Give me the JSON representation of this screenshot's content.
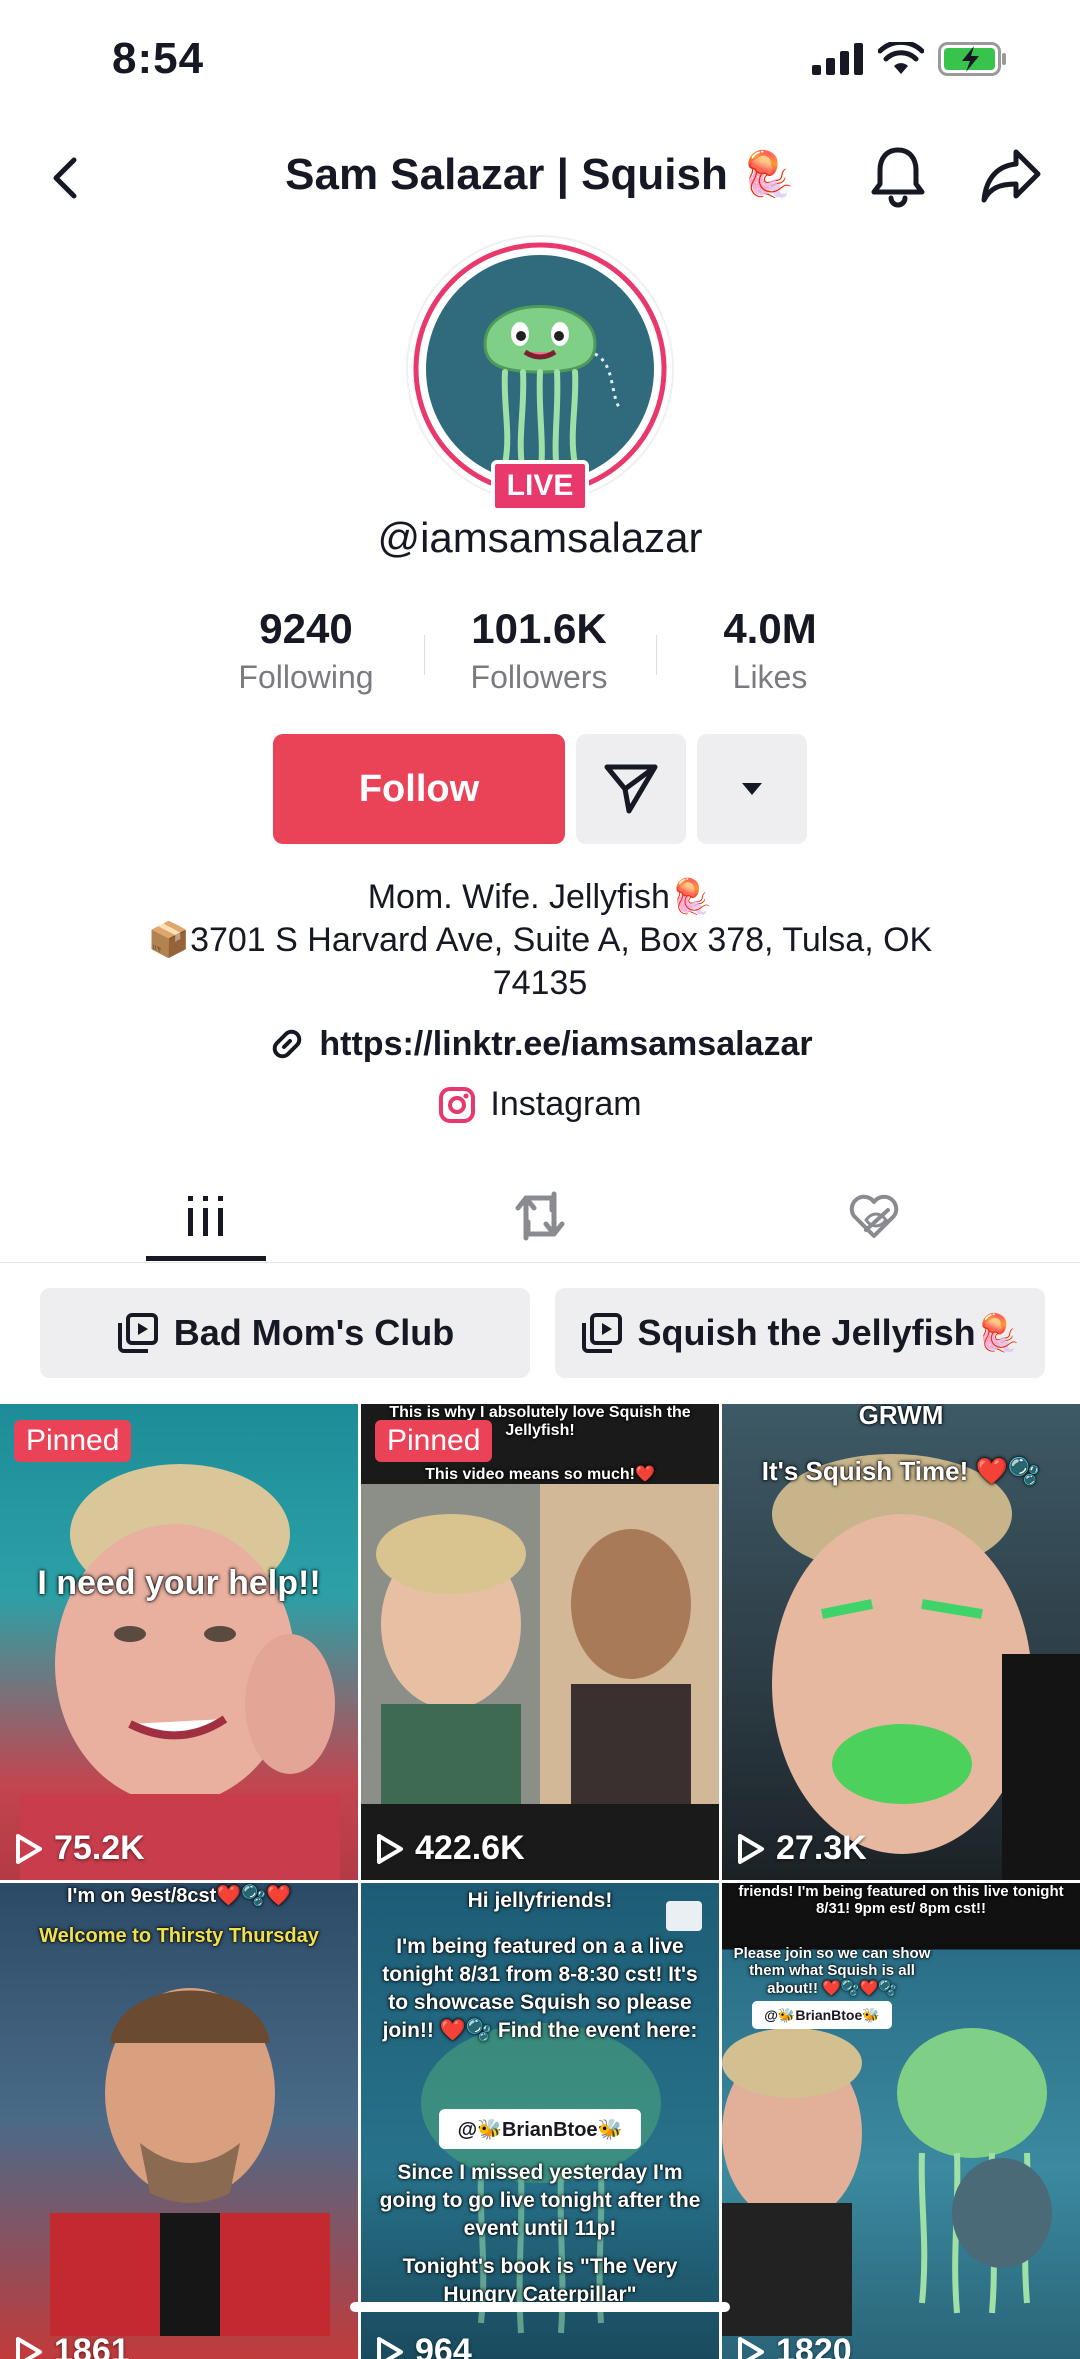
{
  "status_bar": {
    "time": "8:54"
  },
  "nav": {
    "title": "Sam Salazar | Squish 🪼"
  },
  "profile": {
    "live_label": "LIVE",
    "username": "@iamsamsalazar",
    "stats": [
      {
        "value": "9240",
        "label": "Following"
      },
      {
        "value": "101.6K",
        "label": "Followers"
      },
      {
        "value": "4.0M",
        "label": "Likes"
      }
    ],
    "follow_label": "Follow",
    "bio_line1": "Mom. Wife. Jellyfish🪼",
    "bio_line2": "📦3701 S Harvard Ave, Suite A, Box 378, Tulsa, OK 74135",
    "link": "https://linktr.ee/iamsamsalazar",
    "instagram": "Instagram"
  },
  "playlists": [
    {
      "label": "Bad Mom's Club"
    },
    {
      "label": "Squish the Jellyfish🪼"
    }
  ],
  "videos": [
    {
      "pinned": "Pinned",
      "views": "75.2K",
      "caption": "I need your help!!"
    },
    {
      "pinned": "Pinned",
      "views": "422.6K",
      "caption_top": "This is why I absolutely love Squish the Jellyfish!",
      "caption_sub": "This video means so much!❤️"
    },
    {
      "views": "27.3K",
      "caption_top": "GRWM",
      "caption": "It's Squish Time! ❤️🫧"
    },
    {
      "views": "1861",
      "caption_top": "I'm on 9est/8cst❤️🫧❤️",
      "caption": "Welcome to Thirsty Thursday"
    },
    {
      "views": "964",
      "caption_top": "Hi jellyfriends!",
      "caption": "I'm being featured on a a live tonight 8/31 from 8-8:30 cst! It's to showcase Squish so please join!! ❤️🫧 Find the event here:",
      "tag": "@🐝BrianBtoe🐝",
      "caption2": "Since I missed yesterday I'm going to go live tonight after the event until 11p!",
      "caption3": "Tonight's book is \"The Very Hungry Caterpillar\""
    },
    {
      "views": "1820",
      "caption_top": "friends! I'm being featured on this live tonight 8/31! 9pm est/ 8pm cst!!",
      "caption": "Please join so we can show them what Squish is all about!! ❤️🫧❤️🫧",
      "tag": "@🐝BrianBtoe🐝"
    }
  ]
}
